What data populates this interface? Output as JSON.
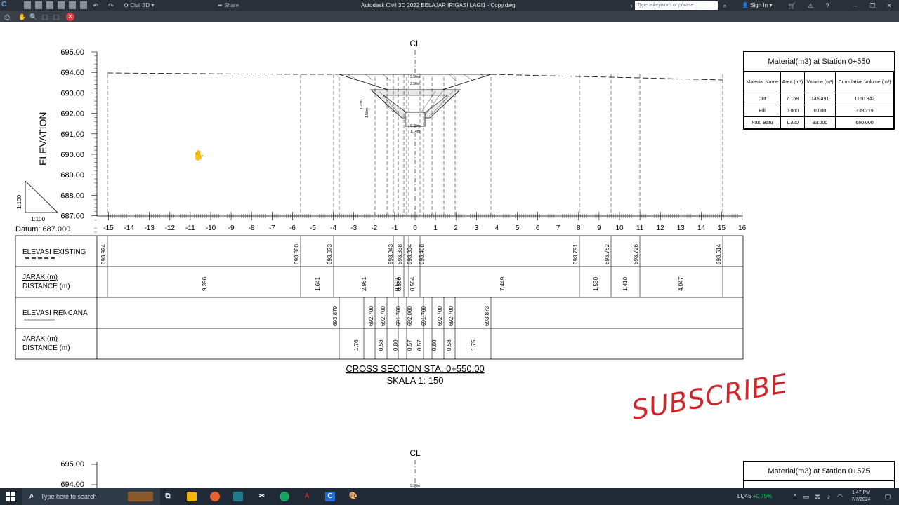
{
  "titlebar": {
    "app_logo": "C",
    "workspace": "Civil 3D",
    "share": "Share",
    "title": "Autodesk Civil 3D 2022   BELAJAR IRIGASI LAGI1 - Copy.dwg",
    "search_placeholder": "Type a keyword or phrase",
    "sign_in": "Sign In"
  },
  "section1": {
    "cl_label": "CL",
    "elevation_label": "ELEVATION",
    "y_ticks": [
      "695.00",
      "694.00",
      "693.00",
      "692.00",
      "691.00",
      "690.00",
      "689.00",
      "688.00",
      "687.00"
    ],
    "x_ticks": [
      "-15",
      "-14",
      "-13",
      "-12",
      "-11",
      "-10",
      "-9",
      "-8",
      "-7",
      "-6",
      "-5",
      "-4",
      "-3",
      "-2",
      "-1",
      "0",
      "1",
      "2",
      "3",
      "4",
      "5",
      "6",
      "7",
      "8",
      "9",
      "10",
      "11",
      "12",
      "13",
      "14",
      "15",
      "16"
    ],
    "datum": "Datum: 687.000",
    "scale_v": "1:100",
    "scale_h": "1:100",
    "dims": {
      "top_w": "3.90m",
      "mid_w": "2.50m",
      "h1": "1.20m",
      "h2": "1.50m",
      "base_h": "0.30m",
      "base_w": "1.14m"
    },
    "rows": {
      "existing_label": "ELEVASI EXISTING",
      "jarak1": "JARAK (m)",
      "distance1": "DISTANCE (m)",
      "rencana_label": "ELEVASI RENCANA",
      "jarak2": "JARAK (m)",
      "distance2": "DISTANCE (m)"
    },
    "existing_values": [
      "693.924",
      "693.880",
      "693.873",
      "693.943",
      "693.338",
      "693.334",
      "693.408",
      "693.791",
      "693.762",
      "693.726",
      "693.614"
    ],
    "existing_dist": [
      "9.396",
      "1.641",
      "2.961",
      "0.501",
      "0.500",
      "0.564",
      "7.449",
      "1.530",
      "1.410",
      "4.047"
    ],
    "rencana_values": [
      "693.879",
      "692.700",
      "692.700",
      "691.700",
      "692.000",
      "691.700",
      "692.700",
      "692.700",
      "693.873"
    ],
    "rencana_dist": [
      "1.76",
      "0.58",
      "0.80",
      "0.57",
      "0.57",
      "0.80",
      "0.58",
      "1.75"
    ],
    "caption": "CROSS SECTION STA. 0+550.00",
    "scale_caption": "SKALA 1: 150"
  },
  "material1": {
    "title": "Material(m3) at Station 0+550",
    "headers": [
      "Material Name",
      "Area (m²)",
      "Volume (m³)",
      "Cumulative Volume (m³)"
    ],
    "rows": [
      [
        "Cut",
        "7.168",
        "145.491",
        "1160.842"
      ],
      [
        "Fill",
        "0.000",
        "0.000",
        "339.219"
      ],
      [
        "Pas. Batu",
        "1.320",
        "33.000",
        "660.000"
      ]
    ]
  },
  "section2": {
    "cl_label": "CL",
    "y_ticks": [
      "695.00",
      "694.00"
    ],
    "top_w": "3.90m"
  },
  "material2": {
    "title": "Material(m3) at Station 0+575"
  },
  "overlay": {
    "subscribe": "SUBSCRIBE"
  },
  "taskbar": {
    "search_placeholder": "Type here to search",
    "stock_name": "LQ45",
    "stock_change": "+0.75%",
    "time": "1:47 PM",
    "date": "7/7/2024"
  },
  "colors": {
    "accent": "#4fa3ff",
    "subscribe": "#d0262a",
    "stock_up": "#22c55e"
  }
}
